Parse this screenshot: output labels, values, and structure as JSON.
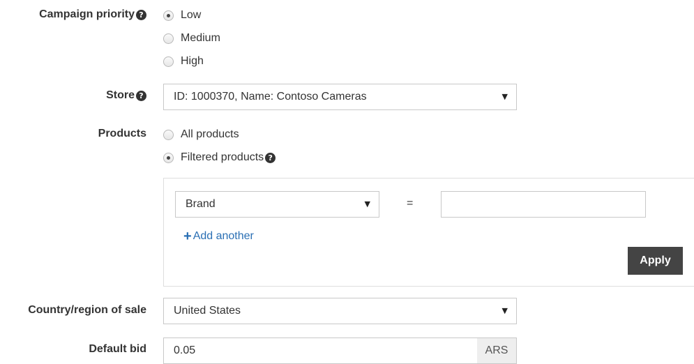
{
  "campaign_priority": {
    "label": "Campaign priority",
    "help_icon": "question-circle-icon",
    "options": [
      {
        "label": "Low",
        "checked": true
      },
      {
        "label": "Medium",
        "checked": false
      },
      {
        "label": "High",
        "checked": false
      }
    ]
  },
  "store": {
    "label": "Store",
    "help_icon": "question-circle-icon",
    "value": "ID: 1000370, Name: Contoso Cameras"
  },
  "products": {
    "label": "Products",
    "options": [
      {
        "label": "All products",
        "checked": false
      },
      {
        "label": "Filtered products",
        "checked": true
      }
    ],
    "filter": {
      "attribute": "Brand",
      "operator": "=",
      "value": "",
      "add_another": "Add another",
      "apply": "Apply"
    }
  },
  "country": {
    "label": "Country/region of sale",
    "value": "United States"
  },
  "default_bid": {
    "label": "Default bid",
    "value": "0.05",
    "currency": "ARS"
  },
  "icons": {
    "help": "?",
    "dropdown": "▼",
    "plus": "+"
  },
  "colors": {
    "link": "#2a6fb4",
    "apply_button": "#444444"
  }
}
